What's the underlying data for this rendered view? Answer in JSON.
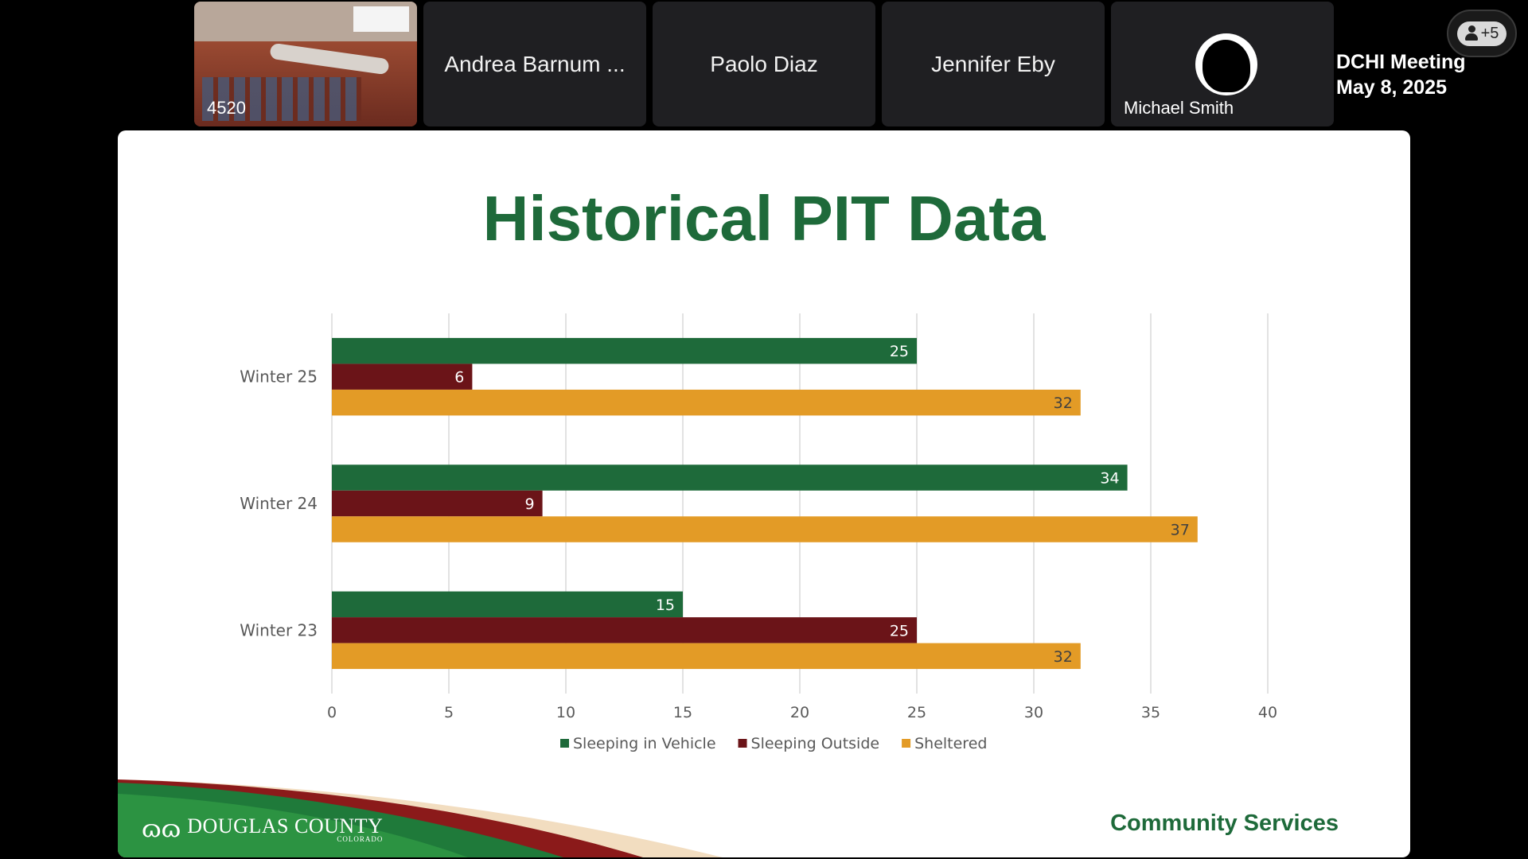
{
  "participants": {
    "room_tile": {
      "tag": "4520"
    },
    "tiles": [
      {
        "name": "Andrea Barnum ..."
      },
      {
        "name": "Paolo Diaz"
      },
      {
        "name": "Jennifer Eby"
      }
    ],
    "avatar_tile": {
      "name": "Michael Smith",
      "icon": "person-silhouette-icon"
    }
  },
  "meeting": {
    "title": "DCHI Meeting",
    "date": "May 8, 2025"
  },
  "people_button": {
    "label": "+5",
    "icon": "person-icon"
  },
  "slide": {
    "title": "Historical PIT Data",
    "logo": {
      "mark": "ɷɷ",
      "name": "DOUGLAS COUNTY",
      "state": "COLORADO"
    },
    "department": "Community Services"
  },
  "chart_data": {
    "type": "bar",
    "orientation": "horizontal",
    "categories": [
      "Winter 25",
      "Winter 24",
      "Winter 23"
    ],
    "series": [
      {
        "name": "Sleeping in Vehicle",
        "color": "#1e6a3a",
        "values": [
          25,
          34,
          15
        ]
      },
      {
        "name": "Sleeping Outside",
        "color": "#6b1418",
        "values": [
          6,
          9,
          25
        ]
      },
      {
        "name": "Sheltered",
        "color": "#e39b26",
        "values": [
          32,
          37,
          32
        ]
      }
    ],
    "xlim": [
      0,
      40
    ],
    "xticks": [
      "0",
      "5",
      "10",
      "15",
      "20",
      "25",
      "30",
      "35",
      "40"
    ],
    "grid": "vertical",
    "legend": "bottom",
    "data_labels": true
  }
}
